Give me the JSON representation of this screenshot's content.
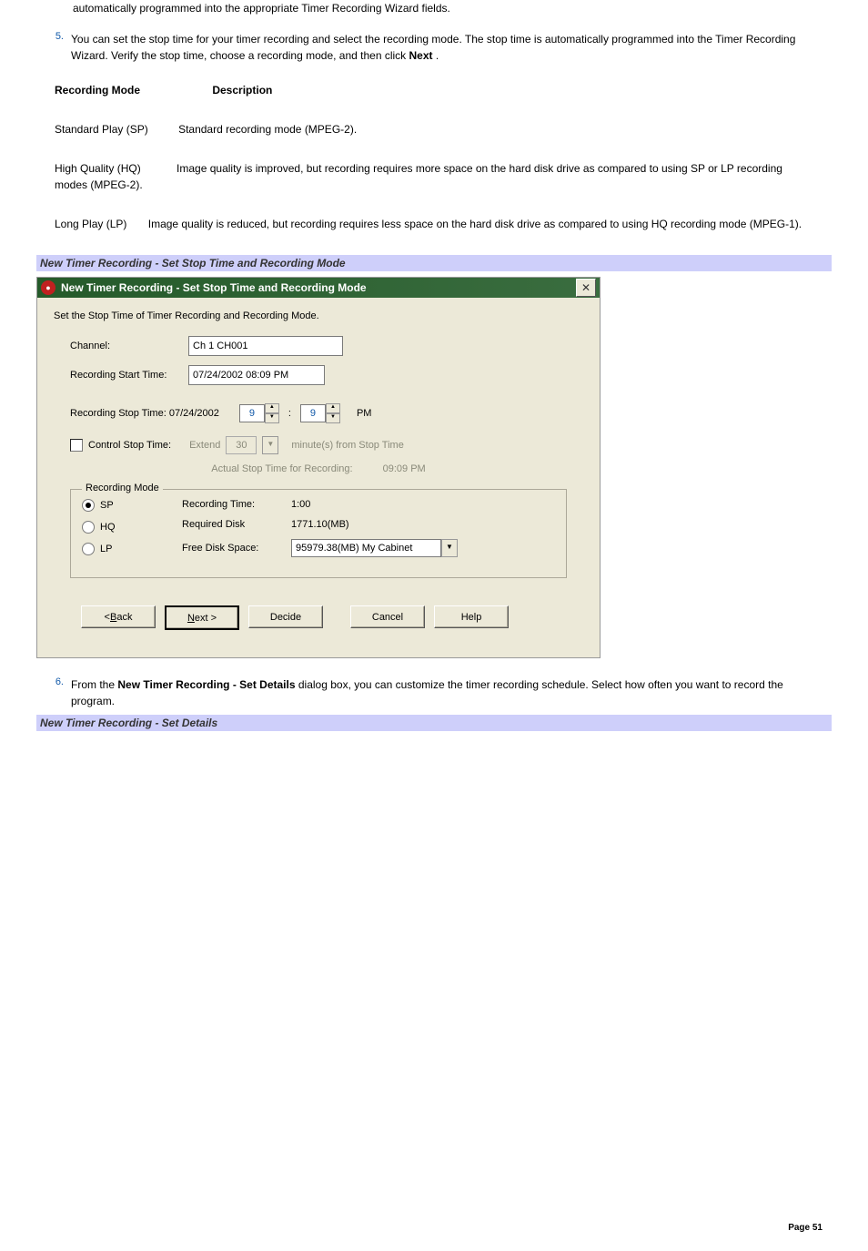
{
  "prelist": {
    "continuation": "automatically programmed into the appropriate Timer Recording Wizard fields."
  },
  "step5": {
    "marker": "5.",
    "text_a": "You can set the stop time for your timer recording and select the recording mode. The stop time is automatically programmed into the Timer Recording Wizard. Verify the stop time, choose a recording mode, and then click ",
    "text_b": "Next",
    "text_c": " ."
  },
  "modeTable": {
    "col1": "Recording Mode",
    "col2": "Description",
    "rows": [
      {
        "name": "Standard Play (SP)",
        "desc": "Standard recording mode (MPEG-2).",
        "inline_gap": "30px"
      },
      {
        "name": "High Quality (HQ)",
        "desc": "Image quality is improved, but recording requires more space on the hard disk drive as compared to using SP or LP recording modes (MPEG-2).",
        "inline_gap": "36px"
      },
      {
        "name": "Long Play (LP)",
        "desc": "Image quality is reduced, but recording requires less space on the hard disk drive as compared to using HQ recording mode (MPEG-1).",
        "inline_gap": "20px"
      }
    ]
  },
  "caption1": "New Timer Recording - Set Stop Time and Recording Mode",
  "dialog": {
    "title": "New Timer Recording - Set Stop Time and Recording Mode",
    "subtext": "Set the Stop Time of Timer Recording and Recording Mode.",
    "channel_label": "Channel:",
    "channel_value": "Ch 1 CH001",
    "start_label": "Recording Start Time:",
    "start_value": "07/24/2002 08:09 PM",
    "stop_label": "Recording Stop Time: 07/24/2002",
    "stop_hour": "9",
    "stop_min": "9",
    "stop_ampm": "PM",
    "control_label": "Control Stop Time:",
    "extend_label": "Extend",
    "extend_value": "30",
    "extend_suffix": "minute(s) from Stop Time",
    "actual_label": "Actual Stop Time for Recording:",
    "actual_value": "09:09 PM",
    "mode_legend": "Recording Mode",
    "radios": {
      "sp": "SP",
      "hq": "HQ",
      "lp": "LP"
    },
    "rec_time_label": "Recording Time:",
    "rec_time_value": "1:00",
    "req_disk_label": "Required Disk",
    "req_disk_value": "1771.10(MB)",
    "free_label": "Free Disk Space:",
    "free_value": "95979.38(MB) My Cabinet",
    "buttons": {
      "back_pre": "< ",
      "back_u": "B",
      "back_post": "ack",
      "next_u": "N",
      "next_post": "ext >",
      "decide": "Decide",
      "cancel": "Cancel",
      "help": "Help"
    }
  },
  "step6": {
    "marker": "6.",
    "text_a": "From the ",
    "text_b": "New Timer Recording - Set Details",
    "text_c": " dialog box, you can customize the timer recording schedule. Select how often you want to record the program."
  },
  "caption2": "New Timer Recording - Set Details",
  "footer": "Page 51"
}
